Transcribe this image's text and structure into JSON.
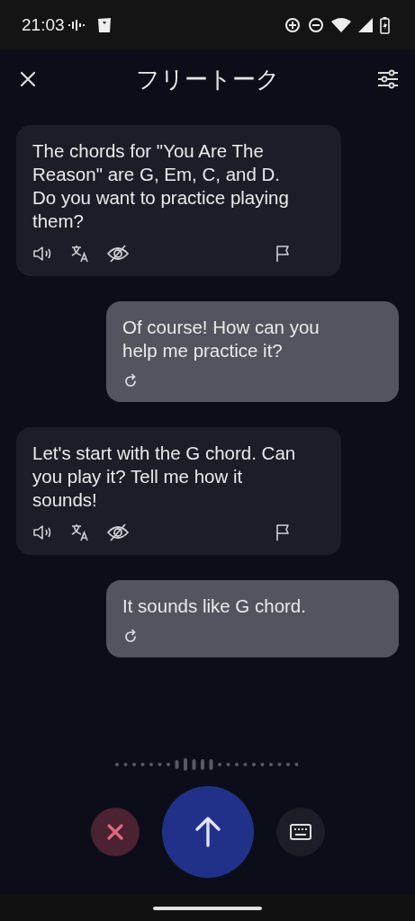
{
  "status_bar": {
    "time": "21:03"
  },
  "header": {
    "title": "フリートーク"
  },
  "messages": [
    {
      "kind": "bot",
      "text": "The chords for \"You Are The Reason\" are G, Em, C, and D. Do you want to practice playing them?"
    },
    {
      "kind": "user",
      "text": "Of course! How can you help me practice it?"
    },
    {
      "kind": "bot",
      "text": "Let's start with the G chord. Can you play it? Tell me how it sounds!"
    },
    {
      "kind": "user",
      "text": "It sounds like G chord."
    }
  ]
}
